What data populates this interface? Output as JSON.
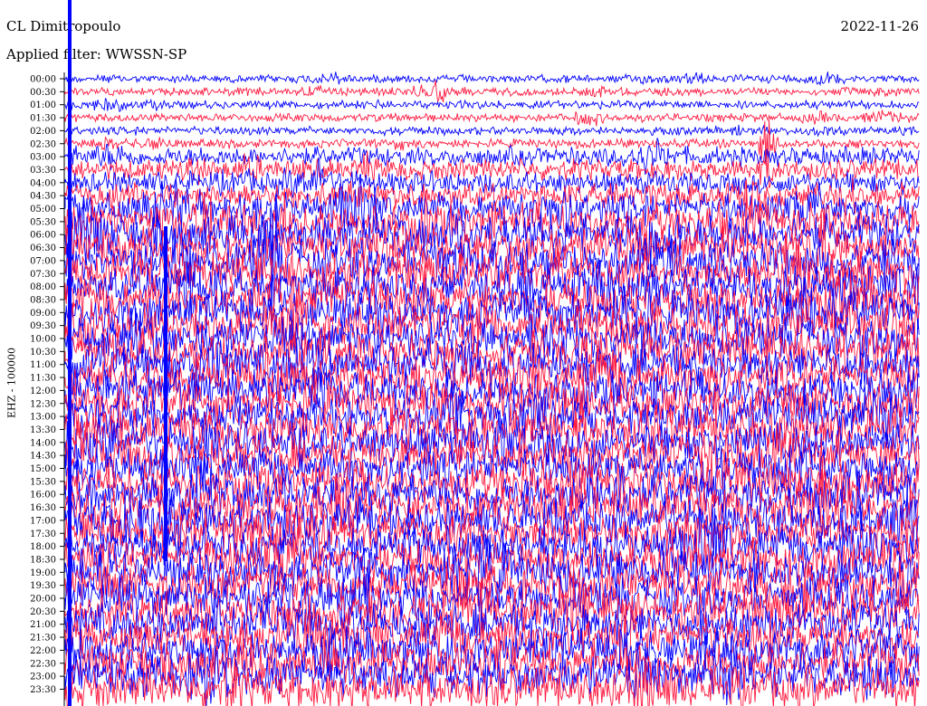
{
  "header": {
    "station": "CL Dimitropoulo",
    "date": "2022-11-26",
    "filter_label": "Applied filter: WWSSN-SP"
  },
  "axis": {
    "channel_label": "EHZ - 100000"
  },
  "colors": {
    "odd_trace": "#0000ff",
    "even_trace": "#ff1a40",
    "background": "#ffffff"
  },
  "chart_data": {
    "type": "line",
    "title": "CL Dimitropoulo",
    "subtitle": "Applied filter: WWSSN-SP",
    "ylabel": "EHZ - 100000",
    "xlabel": "",
    "grid": false,
    "legend": "none",
    "row_labels": [
      "00:00",
      "00:30",
      "01:00",
      "01:30",
      "02:00",
      "02:30",
      "03:00",
      "03:30",
      "04:00",
      "04:30",
      "05:00",
      "05:30",
      "06:00",
      "06:30",
      "07:00",
      "07:30",
      "08:00",
      "08:30",
      "09:00",
      "09:30",
      "10:00",
      "10:30",
      "11:00",
      "11:30",
      "12:00",
      "12:30",
      "13:00",
      "13:30",
      "14:00",
      "14:30",
      "15:00",
      "15:30",
      "16:00",
      "16:30",
      "17:00",
      "17:30",
      "18:00",
      "18:30",
      "19:00",
      "19:30",
      "20:00",
      "20:30",
      "21:00",
      "21:30",
      "22:00",
      "22:30",
      "23:00",
      "23:30"
    ],
    "trace_colors": [
      "#0000ff",
      "#ff1a40"
    ],
    "relative_amplitude": [
      0.22,
      0.22,
      0.24,
      0.24,
      0.26,
      0.3,
      0.4,
      0.45,
      0.5,
      0.6,
      0.75,
      1.0,
      1.05,
      1.05,
      1.0,
      1.0,
      1.0,
      1.0,
      1.0,
      1.0,
      1.0,
      1.0,
      1.0,
      1.0,
      1.0,
      1.0,
      1.0,
      1.0,
      1.0,
      1.0,
      1.0,
      1.0,
      1.0,
      1.0,
      1.0,
      1.0,
      1.0,
      1.0,
      1.0,
      1.0,
      1.05,
      1.1,
      1.1,
      1.1,
      1.05,
      1.05,
      1.05,
      1.1
    ]
  }
}
